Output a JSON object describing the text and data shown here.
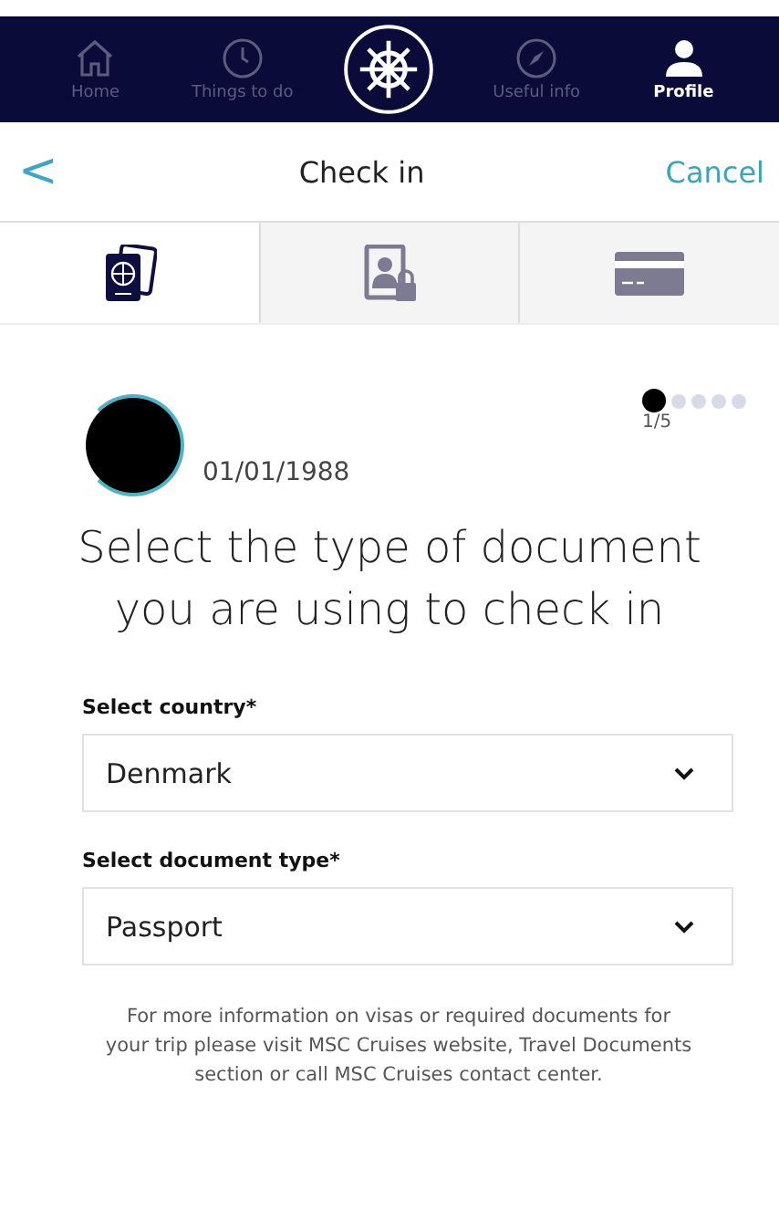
{
  "nav": [
    {
      "kind": "home",
      "label": "Home",
      "selected": false
    },
    {
      "kind": "clock",
      "label": "Things to do",
      "selected": false
    },
    {
      "kind": "wheel",
      "selected": false
    },
    {
      "kind": "compass",
      "label": "Useful info",
      "selected": false
    },
    {
      "kind": "person",
      "label": "Profile",
      "selected": true
    }
  ],
  "header": {
    "back": "<",
    "title": "Check in",
    "cancel": "Cancel"
  },
  "steps": [
    {
      "kind": "passport",
      "selected": true
    },
    {
      "kind": "photo-id",
      "selected": false
    },
    {
      "kind": "card",
      "selected": false
    }
  ],
  "guest": {
    "birthdate": "01/01/1988"
  },
  "progress": {
    "dots": [
      {
        "selected": true
      },
      {
        "selected": false
      },
      {
        "selected": false
      },
      {
        "selected": false
      },
      {
        "selected": false
      }
    ],
    "label": "1/5"
  },
  "heading": "Select the type of document you are using to check in",
  "fields": [
    {
      "label": "Select country*",
      "value": "Denmark"
    },
    {
      "label": "Select document type*",
      "value": "Passport"
    }
  ],
  "note": "For more information on visas or required documents for your trip please visit MSC Cruises website, Travel Documents section or call MSC Cruises contact center."
}
